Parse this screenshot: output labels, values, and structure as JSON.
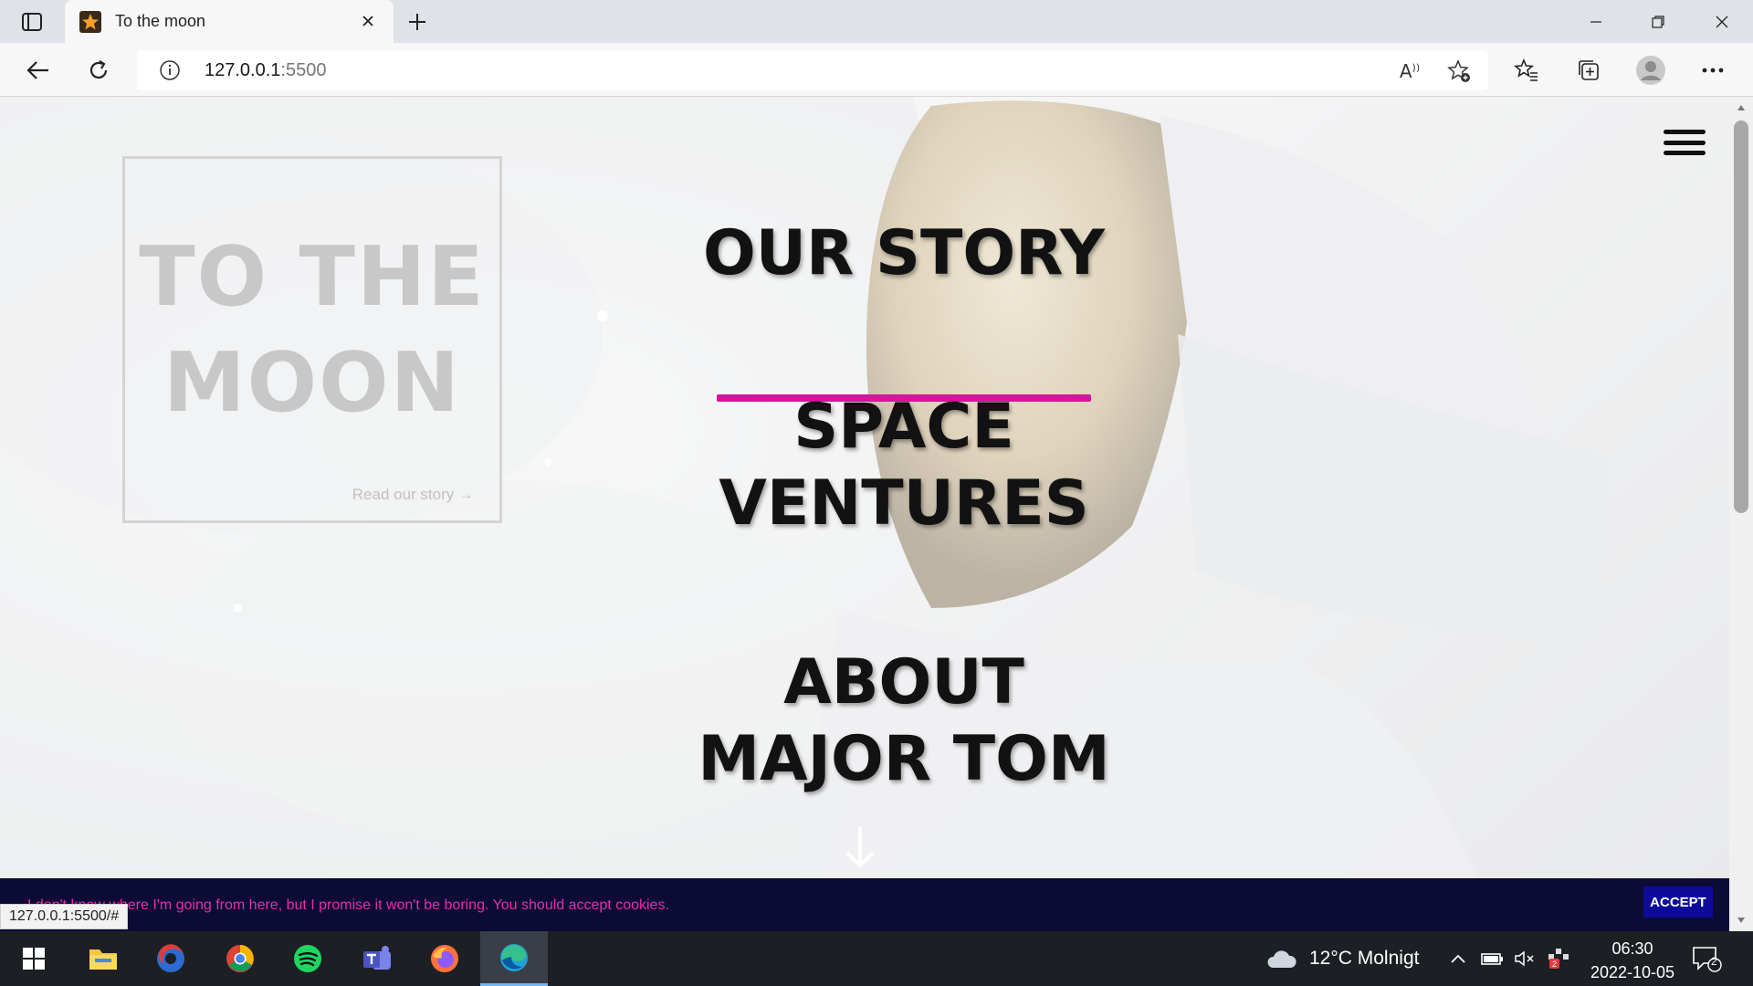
{
  "browser": {
    "tab_title": "To the moon",
    "url_host": "127.0.0.1",
    "url_port": ":5500",
    "status_url": "127.0.0.1:5500/#"
  },
  "page": {
    "logo_line1": "TO THE",
    "logo_line2": "MOON",
    "read_link": "Read our story →",
    "menu": [
      {
        "label": "OUR STORY"
      },
      {
        "label_line1": "SPACE",
        "label_line2": "VENTURES"
      },
      {
        "label_line1": "ABOUT",
        "label_line2": "MAJOR TOM"
      }
    ],
    "accent_color": "#d4169a",
    "cookie_text": "I don't know where I'm going from here, but I promise it won't be boring. You should accept cookies.",
    "accept_label": "ACCEPT"
  },
  "taskbar": {
    "weather": "12°C  Molnigt",
    "time": "06:30",
    "date": "2022-10-05",
    "notification_count": "2",
    "apps": [
      "start",
      "file-explorer",
      "edge-dev",
      "chrome",
      "spotify",
      "teams",
      "firefox",
      "edge"
    ]
  }
}
